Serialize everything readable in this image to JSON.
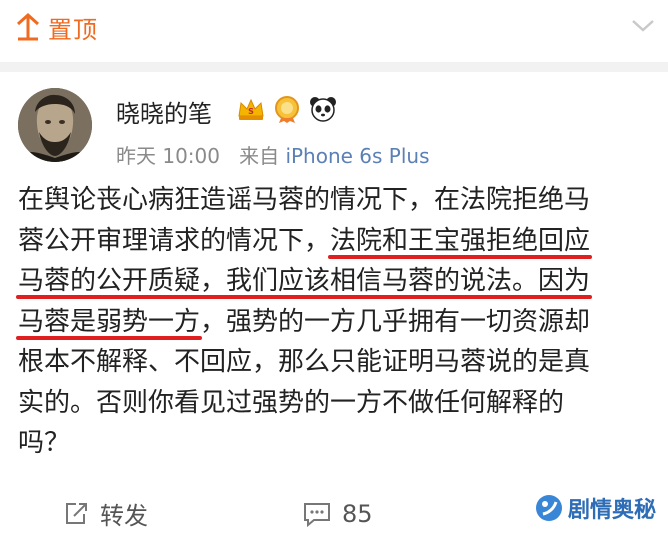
{
  "topbar": {
    "pin_label": "置顶"
  },
  "author": {
    "name": "晓晓的笔",
    "badges": [
      "crown-badge",
      "medal-badge",
      "panda-badge"
    ]
  },
  "meta": {
    "time": "昨天 10:00",
    "from_prefix": "来自",
    "source": "iPhone 6s Plus"
  },
  "post": {
    "line1": "在舆论丧心病狂造谣马蓉的情况下，在法院拒绝马",
    "line2_a": "蓉公开审理请求的情况下，",
    "line2_hl": "法院和王宝强拒绝回应",
    "line3_hl": "马蓉的公开质疑，我们应该相信马蓉的说法。因为",
    "line4_hl": "马蓉是弱势一方",
    "line4_b": "，强势的一方几乎拥有一切资源却",
    "line5": "根本不解释、不回应，那么只能证明马蓉说的是真",
    "line6": "实的。否则你看见过强势的一方不做任何解释的",
    "line7": "吗？"
  },
  "actions": {
    "repost_label": "转发",
    "comment_count": "85"
  },
  "watermark": {
    "text": "剧情奥秘"
  },
  "colors": {
    "accent": "#f06a1f",
    "link": "#5b80b6",
    "underline": "#e02020"
  }
}
